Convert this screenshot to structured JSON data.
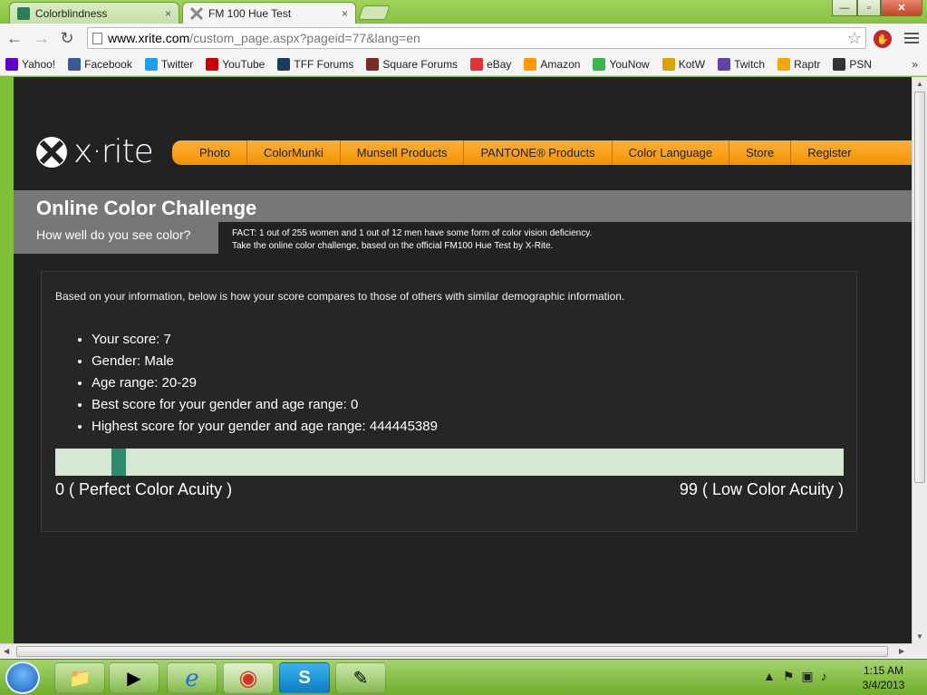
{
  "browser": {
    "tabs": [
      {
        "title": "Colorblindness",
        "close": "×"
      },
      {
        "title": "FM 100 Hue Test",
        "close": "×"
      }
    ],
    "window_controls": {
      "minimize": "—",
      "maximize": "▫",
      "close": "✕"
    },
    "url_host": "www.xrite.com",
    "url_path": "/custom_page.aspx?pageid=77&lang=en",
    "bookmarks": [
      {
        "label": "Yahoo!",
        "icon": "yahoo-icon",
        "color": "#5f01d1"
      },
      {
        "label": "Facebook",
        "icon": "facebook-icon",
        "color": "#3b5998"
      },
      {
        "label": "Twitter",
        "icon": "twitter-icon",
        "color": "#1da1f2"
      },
      {
        "label": "YouTube",
        "icon": "youtube-icon",
        "color": "#cc0000"
      },
      {
        "label": "TFF Forums",
        "icon": "tff-icon",
        "color": "#1b3a5c"
      },
      {
        "label": "Square Forums",
        "icon": "square-icon",
        "color": "#7a2b2b"
      },
      {
        "label": "eBay",
        "icon": "ebay-icon",
        "color": "#e53238"
      },
      {
        "label": "Amazon",
        "icon": "amazon-icon",
        "color": "#ff9900"
      },
      {
        "label": "YouNow",
        "icon": "younow-icon",
        "color": "#39b54a"
      },
      {
        "label": "KotW",
        "icon": "kotw-icon",
        "color": "#d9a400"
      },
      {
        "label": "Twitch",
        "icon": "twitch-icon",
        "color": "#6441a5"
      },
      {
        "label": "Raptr",
        "icon": "raptr-icon",
        "color": "#f2a900"
      },
      {
        "label": "PSN",
        "icon": "psn-icon",
        "color": "#333333"
      }
    ],
    "bookmarks_more": "»"
  },
  "site": {
    "logo_text": "x·rite",
    "nav": [
      "Photo",
      "ColorMunki",
      "Munsell Products",
      "PANTONE® Products",
      "Color Language",
      "Store",
      "Register"
    ],
    "title": "Online Color Challenge",
    "subtitle": "How well do you see color?",
    "fact_line1": "FACT: 1 out of 255 women and 1 out of 12 men have some form of color vision deficiency.",
    "fact_line2": "Take the online color challenge, based on the official FM100 Hue Test by X-Rite.",
    "intro": "Based on your information, below is how your score compares to those of others with similar demographic information.",
    "results": [
      "Your score: 7",
      "Gender: Male",
      "Age range: 20-29",
      "Best score for your gender and age range: 0",
      "Highest score for your gender and age range: 444445389"
    ],
    "scale": {
      "min_label": "0 ( Perfect Color Acuity )",
      "max_label": "99 ( Low Color Acuity )",
      "min": 0,
      "max": 99,
      "score": 7
    },
    "colors": {
      "accent": "#f39200",
      "background": "#222222",
      "marker": "#2e8b6e",
      "scale_bg": "#d5e8d4"
    }
  },
  "taskbar": {
    "apps": [
      {
        "name": "explorer",
        "glyph": "📁"
      },
      {
        "name": "media-player",
        "glyph": "▶"
      },
      {
        "name": "internet-explorer",
        "glyph": "ℯ"
      },
      {
        "name": "chrome",
        "glyph": "◉"
      },
      {
        "name": "skype",
        "glyph": "S"
      },
      {
        "name": "paint",
        "glyph": "✎"
      }
    ],
    "time": "1:15 AM",
    "date": "3/4/2013"
  }
}
